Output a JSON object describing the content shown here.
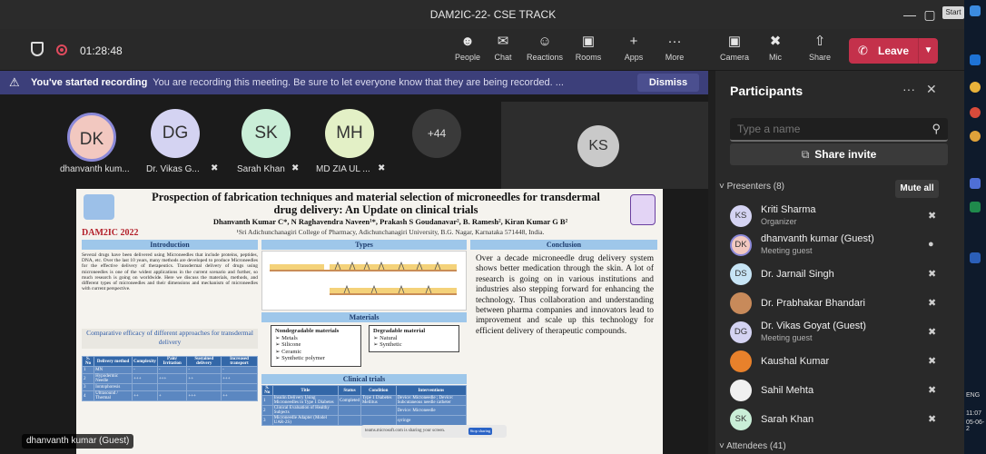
{
  "window": {
    "title": "DAM2IC-22- CSE TRACK",
    "start_chip": "Start",
    "controls": [
      "—",
      "▢",
      "✕"
    ]
  },
  "meeting": {
    "elapsed": "01:28:48"
  },
  "toolbar": {
    "people": "People",
    "chat": "Chat",
    "reactions": "Reactions",
    "rooms": "Rooms",
    "apps": "Apps",
    "more": "More",
    "camera": "Camera",
    "mic": "Mic",
    "share": "Share",
    "leave": "Leave"
  },
  "banner": {
    "bold": "You've started recording",
    "message": "You are recording this meeting. Be sure to let everyone know that they are being recorded. ...",
    "dismiss": "Dismiss"
  },
  "stage": {
    "attendees": [
      {
        "initials": "DK",
        "name": "dhanvanth kum...",
        "color": "#f2c8c0",
        "muted": false
      },
      {
        "initials": "DG",
        "name": "Dr. Vikas G...",
        "color": "#d4d3f2",
        "muted": true
      },
      {
        "initials": "SK",
        "name": "Sarah Khan",
        "color": "#c9eed7",
        "muted": true
      },
      {
        "initials": "MH",
        "name": "MD ZIA UL ...",
        "color": "#e3f0c6",
        "muted": true
      }
    ],
    "overflow": "+44",
    "featured_initials": "KS",
    "speaker_tag": "dhanvanth kumar (Guest)"
  },
  "poster": {
    "title": "Prospection of fabrication techniques and material selection of microneedles for transdermal drug delivery: An Update on clinical trials",
    "authors": "Dhanvanth Kumar C*, N Raghavendra Naveen¹*, Prakash S Goudanavar², B. Ramesh², Kiran Kumar G B²",
    "affiliation": "¹Sri Adichunchanagiri College of Pharmacy, Adichunchanagiri University, B.G. Nagar, Karnataka 571448, India.",
    "event": "DAM2IC 2022",
    "intro_head": "Introduction",
    "intro_text": "Several drugs have been delivered using Microneedles that include proteins, peptides, DNA, etc. Over the last 10 years, many methods are developed to produce Microneedles for the effective delivery of therapeutics. Transdermal delivery of drugs using microneedles is one of the widest applications in the current scenario and further, so much research is going on worldwide. Here we discuss the materials, methods, and different types of microneedles and their dimensions and mechanism of microneedles with current perspective.",
    "compare_head": "Comparative efficacy of different approaches for transdermal delivery",
    "compare_cols": [
      "S. No",
      "Delivery method",
      "Complexity",
      "Pain/ Irritation",
      "Sustained delivery",
      "Increased transport"
    ],
    "compare_rows": [
      [
        "1",
        "MN",
        "-",
        "-",
        "-",
        "-"
      ],
      [
        "2",
        "Hypodermic Needle",
        "+++",
        "+++",
        "++",
        "+++"
      ],
      [
        "3",
        "Iontophoresis",
        "",
        "",
        "",
        ""
      ],
      [
        "4",
        "Ultrasound / Thermal",
        "++",
        "+",
        "+++",
        "++"
      ],
      [
        "5",
        "",
        "",
        "",
        "",
        ""
      ]
    ],
    "types_head": "Types",
    "materials_head": "Materials",
    "mat_nondeg_title": "Nondegradable materials",
    "mat_nondeg": [
      "➢ Metals",
      "➢ Silicone",
      "➢ Ceramic",
      "➢ Synthetic polymer"
    ],
    "mat_deg_title": "Degradable material",
    "mat_deg": [
      "➢ Natural",
      "➢ Synthetic"
    ],
    "clinical_head": "Clinical trials",
    "clinical_cols": [
      "S. No",
      "Title",
      "Status",
      "Condition",
      "Interventions"
    ],
    "clinical_rows": [
      [
        "1",
        "Insulin Delivery Using Microneedles in Type 1 Diabetes",
        "Completed",
        "Type 1 Diabetes Mellitus",
        "Device: Microneedle ; Device: Subcutaneous needle catheter"
      ],
      [
        "2",
        "Clinical Evaluation of Healthy Subjects",
        "",
        "",
        "Device: Microneedle"
      ],
      [
        "3",
        "Microneedle Adapter (Model UAR-2S)",
        "",
        "",
        "syringe"
      ]
    ],
    "conclusion_head": "Conclusion",
    "conclusion_text": "Over a decade microneedle drug delivery system shows better medication through the skin. A lot of research is going on in various institutions and industries also stepping forward for enhancing the technology. Thus collaboration and understanding between pharma companies and innovators lead to improvement and scale up this technology for efficient delivery of therapeutic compounds.",
    "toast_text": "teams.microsoft.com is sharing your screen.",
    "toast_btn": "Stop sharing"
  },
  "panel": {
    "title": "Participants",
    "more": "···",
    "close": "✕",
    "search_placeholder": "Type a name",
    "share_invite": "Share invite",
    "presenters_label": "Presenters (8)",
    "mute_all": "Mute all",
    "attendees_label": "Attendees (41)",
    "presenters": [
      {
        "initials": "KS",
        "name": "Kriti Sharma",
        "role": "Organizer",
        "color": "#d4d3f2",
        "mic": "muted"
      },
      {
        "initials": "DK",
        "name": "dhanvanth kumar (Guest)",
        "role": "Meeting guest",
        "color": "#f2c8c0",
        "mic": "on"
      },
      {
        "initials": "DS",
        "name": "Dr. Jarnail Singh",
        "role": "",
        "color": "#c7e4f5",
        "mic": "muted"
      },
      {
        "initials": "",
        "name": "Dr. Prabhakar Bhandari",
        "role": "",
        "color": "#c88a5a",
        "mic": "muted"
      },
      {
        "initials": "DG",
        "name": "Dr. Vikas Goyat (Guest)",
        "role": "Meeting guest",
        "color": "#d4d3f2",
        "mic": "muted"
      },
      {
        "initials": "",
        "name": "Kaushal Kumar",
        "role": "",
        "color": "#e8812b",
        "mic": "muted"
      },
      {
        "initials": "",
        "name": "Sahil Mehta",
        "role": "",
        "color": "#f0f0f0",
        "mic": "muted"
      },
      {
        "initials": "SK",
        "name": "Sarah Khan",
        "role": "",
        "color": "#c9eed7",
        "mic": "muted"
      }
    ]
  },
  "taskbar": {
    "lang": "ENG",
    "time": "11:07",
    "date": "05-06-2"
  }
}
